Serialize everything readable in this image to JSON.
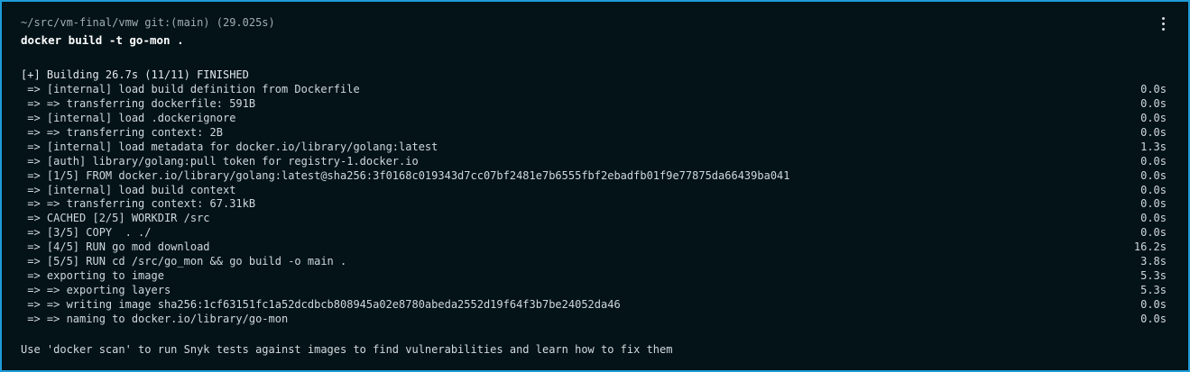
{
  "block": {
    "cwd": "~/src/vm-final/vmw git:(main) (29.025s)",
    "command": "docker build -t go-mon ."
  },
  "output": {
    "header": "[+] Building 26.7s (11/11) FINISHED",
    "steps": [
      {
        "text": " => [internal] load build definition from Dockerfile",
        "duration": "0.0s"
      },
      {
        "text": " => => transferring dockerfile: 591B",
        "duration": "0.0s"
      },
      {
        "text": " => [internal] load .dockerignore",
        "duration": "0.0s"
      },
      {
        "text": " => => transferring context: 2B",
        "duration": "0.0s"
      },
      {
        "text": " => [internal] load metadata for docker.io/library/golang:latest",
        "duration": "1.3s"
      },
      {
        "text": " => [auth] library/golang:pull token for registry-1.docker.io",
        "duration": "0.0s"
      },
      {
        "text": " => [1/5] FROM docker.io/library/golang:latest@sha256:3f0168c019343d7cc07bf2481e7b6555fbf2ebadfb01f9e77875da66439ba041",
        "duration": "0.0s"
      },
      {
        "text": " => [internal] load build context",
        "duration": "0.0s"
      },
      {
        "text": " => => transferring context: 67.31kB",
        "duration": "0.0s"
      },
      {
        "text": " => CACHED [2/5] WORKDIR /src",
        "duration": "0.0s"
      },
      {
        "text": " => [3/5] COPY  . ./",
        "duration": "0.0s"
      },
      {
        "text": " => [4/5] RUN go mod download",
        "duration": "16.2s"
      },
      {
        "text": " => [5/5] RUN cd /src/go_mon && go build -o main .",
        "duration": "3.8s"
      },
      {
        "text": " => exporting to image",
        "duration": "5.3s"
      },
      {
        "text": " => => exporting layers",
        "duration": "5.3s"
      },
      {
        "text": " => => writing image sha256:1cf63151fc1a52dcdbcb808945a02e8780abeda2552d19f64f3b7be24052da46",
        "duration": "0.0s"
      },
      {
        "text": " => => naming to docker.io/library/go-mon",
        "duration": "0.0s"
      }
    ],
    "hint": "Use 'docker scan' to run Snyk tests against images to find vulnerabilities and learn how to fix them"
  },
  "icons": {
    "menu": "kebab-menu-icon"
  },
  "colors": {
    "background": "#031318",
    "selection_border": "#1d9bd7",
    "text": "#d3dadd",
    "muted": "#a0aeb4"
  }
}
